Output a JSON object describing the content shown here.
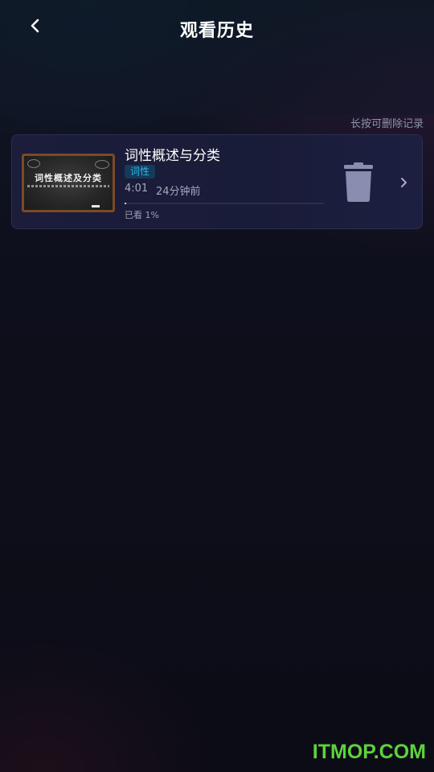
{
  "header": {
    "title": "观看历史",
    "back_icon": "chevron-left-icon"
  },
  "hint": "长按可删除记录",
  "history": [
    {
      "title": "词性概述与分类",
      "thumbnail_text": "词性概述及分类",
      "tag": "词性",
      "duration": "4:01",
      "watched_ago": "24分钟前",
      "progress_percent": 1,
      "progress_label": "已看 1%",
      "delete_icon": "trash-icon",
      "open_icon": "chevron-right-icon"
    }
  ],
  "watermark": "ITMOP.COM",
  "colors": {
    "background": "#0d0d18",
    "card": "#1b1d3a",
    "tag_text": "#2fb6ea",
    "tag_bg": "#153a5a",
    "trash": "#8a8cb0",
    "watermark": "#5ed23c"
  }
}
